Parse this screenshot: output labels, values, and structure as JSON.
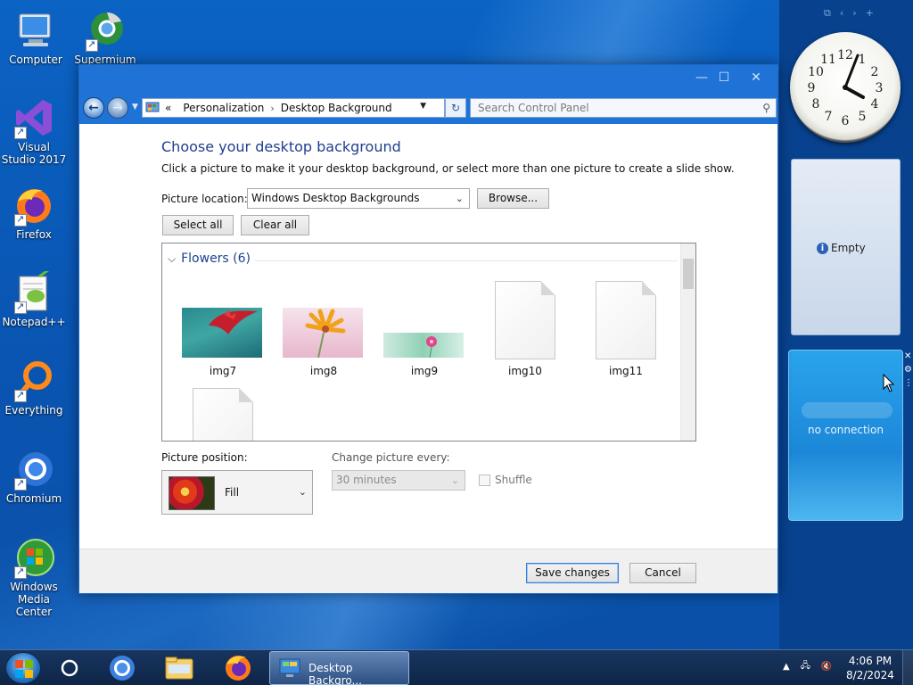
{
  "desktop": {
    "icons": [
      {
        "label": "Computer"
      },
      {
        "label": "Supermium"
      },
      {
        "label": "Visual Studio 2017"
      },
      {
        "label": "Firefox"
      },
      {
        "label": "Notepad++"
      },
      {
        "label": "Everything"
      },
      {
        "label": "Chromium"
      },
      {
        "label": "Windows Media Center"
      }
    ]
  },
  "sidebar": {
    "empty_gadget_label": "Empty",
    "network_gadget_label": "no connection",
    "clock_numerals": [
      "12",
      "1",
      "2",
      "3",
      "4",
      "5",
      "6",
      "7",
      "8",
      "9",
      "10",
      "11"
    ]
  },
  "window": {
    "breadcrumb": {
      "root": "«",
      "items": [
        "Personalization",
        "Desktop Background"
      ]
    },
    "search_placeholder": "Search Control Panel",
    "heading": "Choose your desktop background",
    "subtext": "Click a picture to make it your desktop background, or select more than one picture to create a slide show.",
    "picture_location_label": "Picture location:",
    "picture_location_value": "Windows Desktop Backgrounds",
    "browse_label": "Browse...",
    "select_all_label": "Select all",
    "clear_all_label": "Clear all",
    "group_label": "Flowers (6)",
    "thumbnails": [
      {
        "name": "img7"
      },
      {
        "name": "img8"
      },
      {
        "name": "img9"
      },
      {
        "name": "img10"
      },
      {
        "name": "img11"
      },
      {
        "name": ""
      }
    ],
    "picture_position_label": "Picture position:",
    "picture_position_value": "Fill",
    "change_every_label": "Change picture every:",
    "change_every_value": "30 minutes",
    "shuffle_label": "Shuffle",
    "save_label": "Save changes",
    "cancel_label": "Cancel"
  },
  "taskbar": {
    "active_window_label": "Desktop Backgro...",
    "time": "4:06 PM",
    "date": "8/2/2024"
  }
}
